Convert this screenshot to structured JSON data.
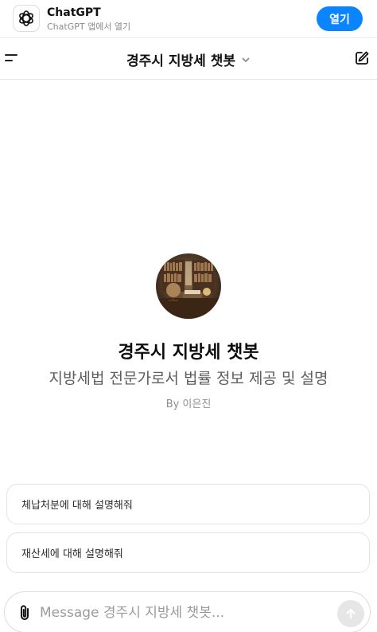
{
  "banner": {
    "app_name": "ChatGPT",
    "app_subtitle": "ChatGPT 앱에서 열기",
    "open_label": "열기",
    "open_color": "#0a84ff"
  },
  "header": {
    "title": "경주시 지방세 챗봇",
    "menu_icon": "menu-icon",
    "chevron_icon": "chevron-down-icon",
    "edit_icon": "new-chat-icon"
  },
  "gpt": {
    "name": "경주시 지방세 챗봇",
    "description": "지방세법 전문가로서 법률 정보 제공 및 설명",
    "author": "By 이은진"
  },
  "suggestions": [
    {
      "label": "체납처분에 대해 설명해줘"
    },
    {
      "label": "재산세에 대해 설명해줘"
    }
  ],
  "composer": {
    "placeholder": "Message 경주시 지방세 챗봇...",
    "value": "",
    "attach_icon": "paperclip-icon",
    "send_icon": "arrow-up-icon"
  }
}
